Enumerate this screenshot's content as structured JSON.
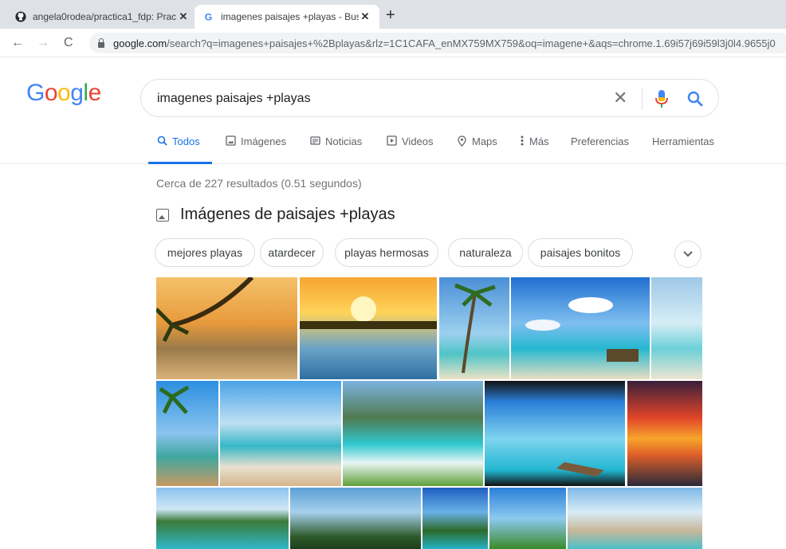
{
  "browser": {
    "tabs": [
      {
        "title": "angela0rodea/practica1_fdp: Prac",
        "favicon": "github-icon"
      },
      {
        "title": "imagenes paisajes +playas - Busc",
        "favicon": "google-icon"
      }
    ],
    "url_host": "google.com",
    "url_path": "/search?q=imagenes+paisajes+%2Bplayas&rlz=1C1CAFA_enMX759MX759&oq=imagene+&aqs=chrome.1.69i57j69i59l3j0l4.9655j0"
  },
  "logo": {
    "letters": [
      "G",
      "o",
      "o",
      "g",
      "l",
      "e"
    ],
    "colors": [
      "#4285f4",
      "#ea4335",
      "#fbbc05",
      "#4285f4",
      "#34a853",
      "#ea4335"
    ]
  },
  "search": {
    "query": "imagenes paisajes +playas",
    "clear_icon": "close-icon",
    "mic_icon": "mic-icon",
    "search_icon": "search-icon"
  },
  "nav": {
    "todos": "Todos",
    "imagenes": "Imágenes",
    "noticias": "Noticias",
    "videos": "Videos",
    "maps": "Maps",
    "mas": "Más",
    "preferencias": "Preferencias",
    "herramientas": "Herramientas"
  },
  "results_count": "Cerca de 227 resultados (0.51 segundos)",
  "images_section": {
    "heading": "Imágenes de paisajes +playas",
    "chips": [
      "mejores playas",
      "atardecer",
      "playas hermosas",
      "naturaleza",
      "paisajes bonitos"
    ]
  },
  "colors": {
    "accent": "#1a73e8",
    "text": "#202124",
    "muted": "#70757a"
  }
}
